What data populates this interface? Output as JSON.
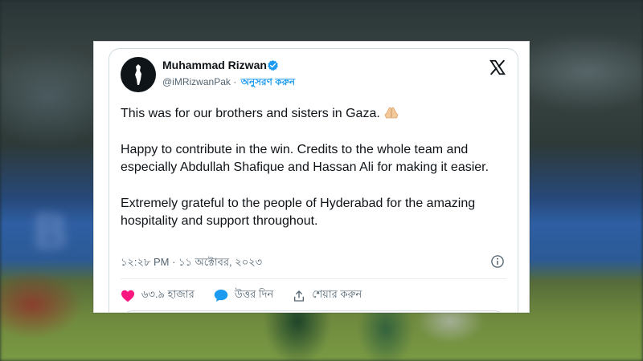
{
  "tweet": {
    "author_name": "Muhammad Rizwan",
    "handle": "@iMRizwanPak",
    "separator": "·",
    "follow_label": "অনুসরণ করুন",
    "paragraphs": [
      "This was for our brothers and sisters in Gaza.",
      "Happy to contribute in the win. Credits to the whole team and especially Abdullah Shafique and Hassan Ali for making it easier.",
      "Extremely grateful to the people of Hyderabad for the amazing hospitality and support throughout."
    ],
    "timestamp": "১২:২৮ PM · ১১ অক্টোবর, ২০২৩",
    "likes_label": "৬৩.৯ হাজার",
    "reply_label": "উত্তর দিন",
    "share_label": "শেয়ার করুন"
  },
  "colors": {
    "accent": "#1d9bf0",
    "like": "#f91880",
    "text": "#0f1419",
    "muted": "#536471"
  },
  "icons": [
    "verified-badge-icon",
    "x-logo-icon",
    "praying-hands-emoji",
    "info-icon",
    "heart-icon",
    "reply-bubble-icon",
    "share-icon"
  ]
}
